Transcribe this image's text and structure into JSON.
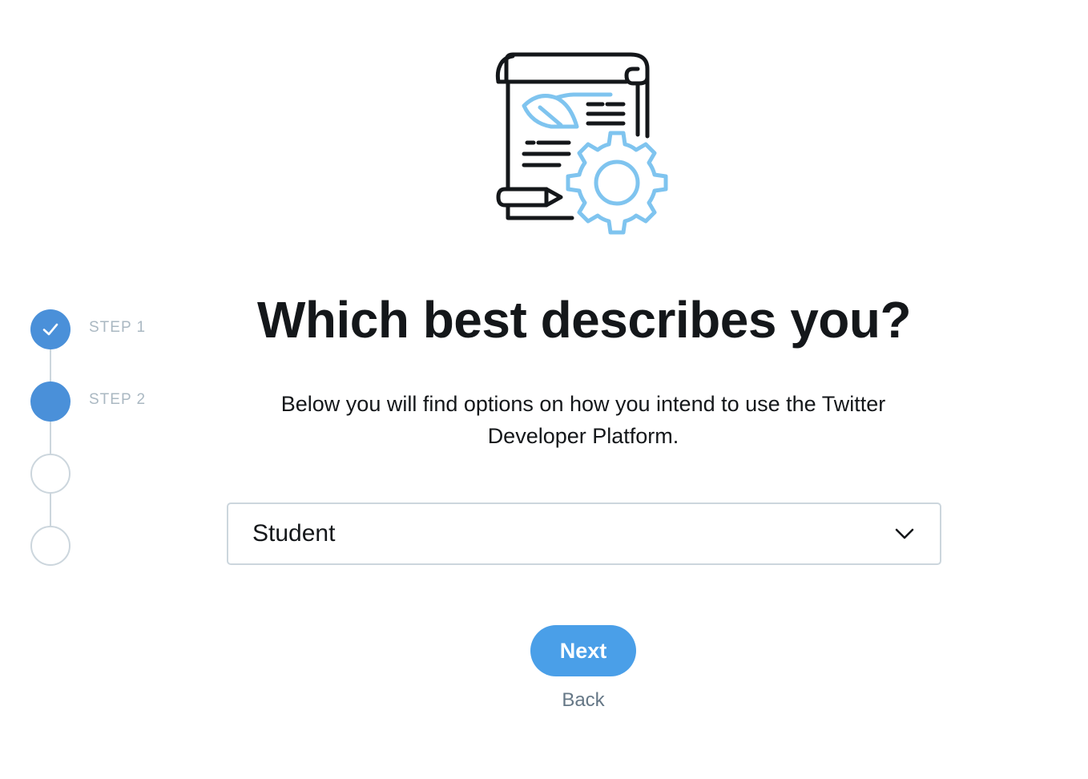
{
  "stepper": {
    "steps": [
      {
        "label": "STEP 1",
        "state": "done"
      },
      {
        "label": "STEP 2",
        "state": "active"
      },
      {
        "label": "",
        "state": "todo"
      },
      {
        "label": "",
        "state": "todo"
      }
    ]
  },
  "illustration": {
    "icon": "scroll-gear-icon"
  },
  "main": {
    "title": "Which best describes you?",
    "subtitle": "Below you will find options on how you intend to use the Twitter Developer Platform.",
    "select": {
      "value": "Student"
    },
    "next_label": "Next",
    "back_label": "Back"
  },
  "colors": {
    "accent": "#4a9fe8",
    "step_active": "#4a90d9",
    "line": "#ccd6dd",
    "muted": "#657786",
    "icon_blue": "#7fc4ef",
    "icon_dark": "#14171a"
  }
}
